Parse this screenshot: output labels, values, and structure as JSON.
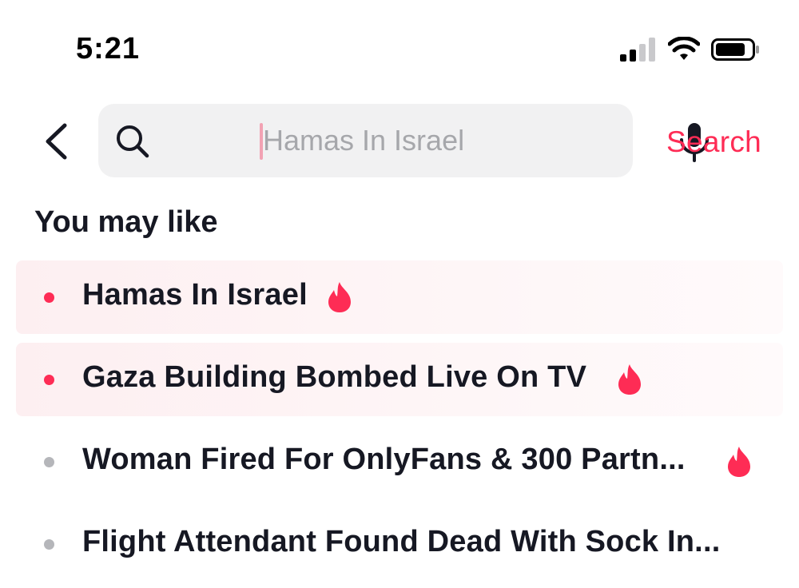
{
  "status_bar": {
    "time": "5:21",
    "signal_icon": "signal-icon",
    "wifi_icon": "wifi-icon",
    "battery_icon": "battery-icon"
  },
  "search": {
    "back_icon": "chevron-left-icon",
    "search_icon": "search-icon",
    "placeholder": "Hamas In Israel",
    "value": "",
    "mic_icon": "microphone-icon",
    "action_label": "Search"
  },
  "section": {
    "title": "You may like"
  },
  "suggestions": [
    {
      "text": "Hamas In Israel",
      "trending": true,
      "highlighted": true
    },
    {
      "text": "Gaza Building Bombed Live On TV",
      "trending": true,
      "highlighted": true
    },
    {
      "text": "Woman Fired For OnlyFans & 300 Partn...",
      "trending": true,
      "highlighted": false
    },
    {
      "text": "Flight Attendant Found Dead With Sock In...",
      "trending": false,
      "highlighted": false
    }
  ],
  "colors": {
    "accent": "#fe2c55",
    "text": "#161823",
    "search_bg": "#f1f1f2",
    "highlight_bg": "#fdeff1",
    "bullet_grey": "#b5b6ba"
  }
}
